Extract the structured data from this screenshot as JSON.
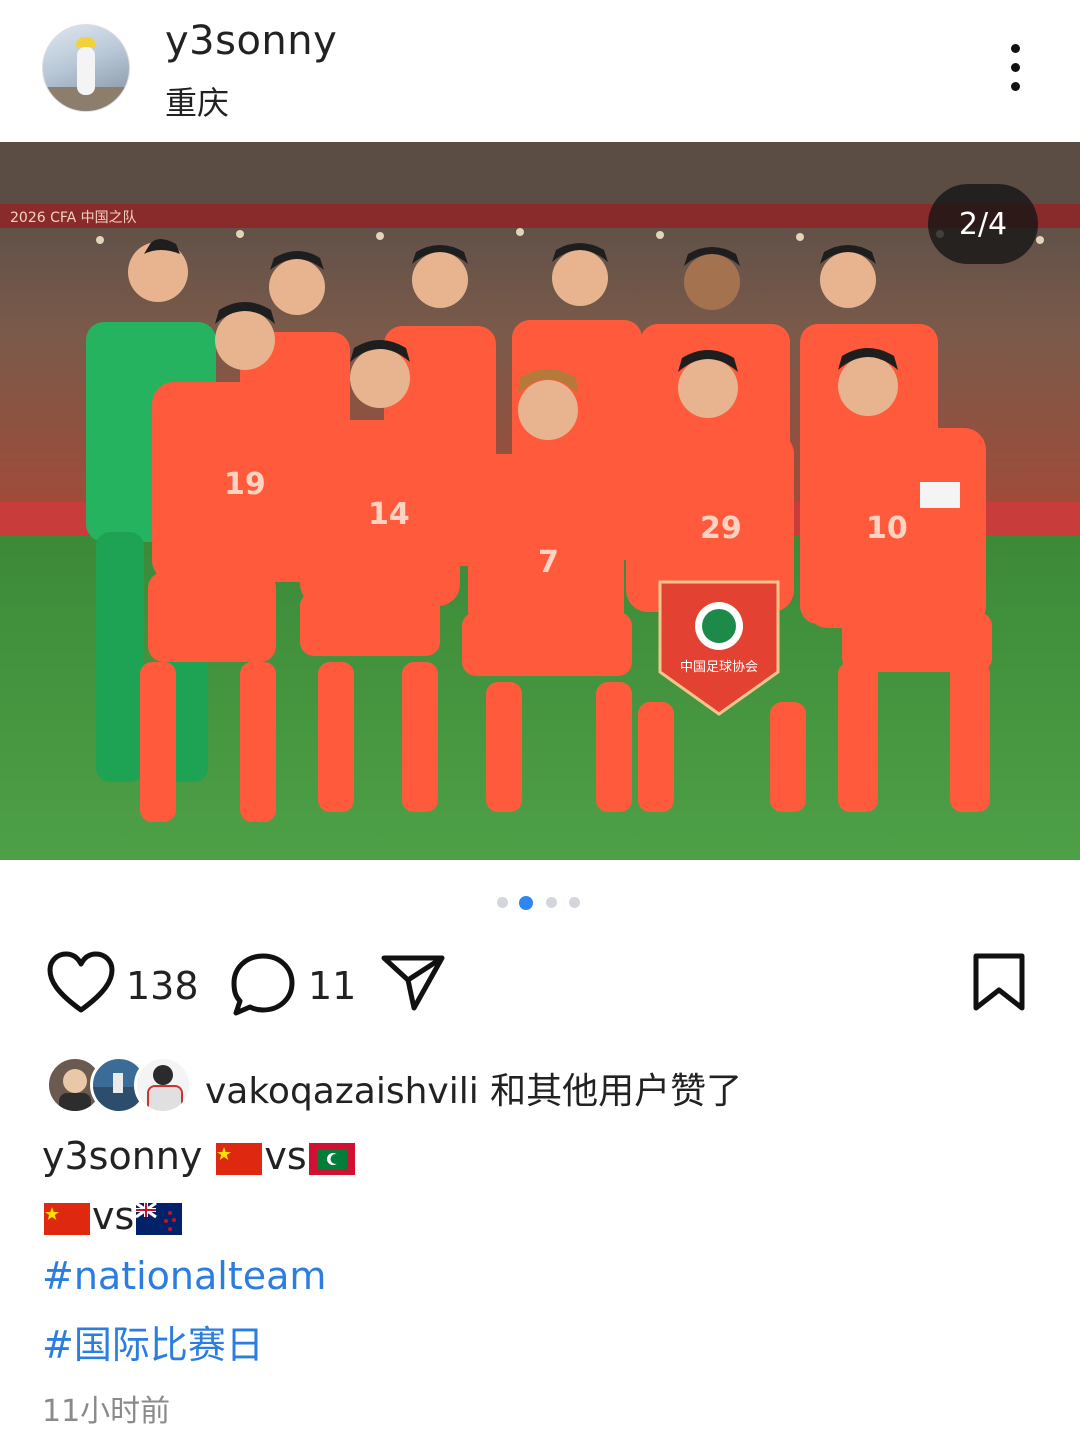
{
  "post": {
    "username": "y3sonny",
    "location": "重庆",
    "image_counter": "2/4",
    "carousel": {
      "total": 4,
      "active_index": 1
    },
    "likes_count": "138",
    "comments_count": "11",
    "liked_by_text": "vakoqazaishvili 和其他用户赞了",
    "caption": {
      "author": "y3sonny",
      "line1_vs": "vs",
      "line2_vs": "vs",
      "flags_line1": [
        "china-flag",
        "maldives-flag"
      ],
      "flags_line2": [
        "china-flag",
        "new-zealand-flag"
      ]
    },
    "hashtags": [
      "#nationalteam",
      "#国际比赛日"
    ],
    "timestamp": "11小时前"
  },
  "photo": {
    "pennant_text": "中国足球协会",
    "jersey_numbers": [
      "19",
      "14",
      "7",
      "29",
      "10"
    ],
    "stadium_banner": "2026 CFA 中国之队"
  },
  "colors": {
    "accent": "#2b7de0",
    "jersey": "#ff5a3c",
    "keeper": "#25b35f",
    "pitch": "#3f8f3a"
  }
}
